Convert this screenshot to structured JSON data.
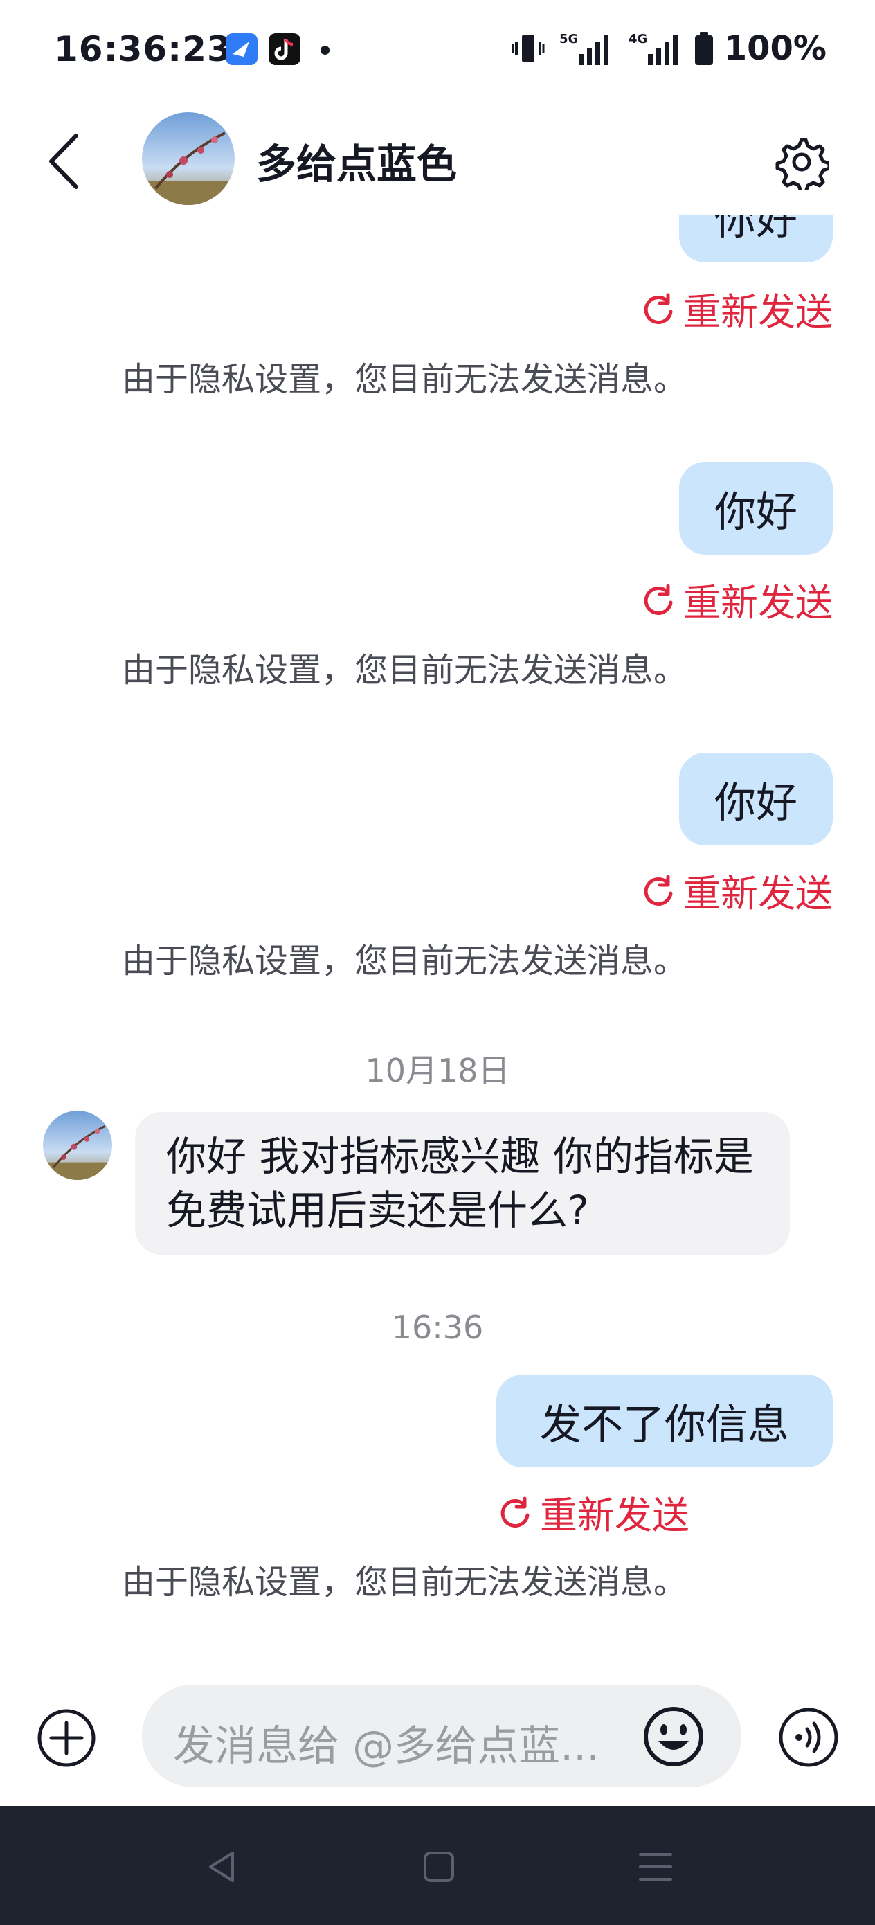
{
  "status_bar": {
    "time": "16:36:23",
    "battery": "100%",
    "net1": "5G",
    "net2": "4G"
  },
  "header": {
    "title": "多给点蓝色"
  },
  "messages": {
    "partial_bubble": "你好",
    "bubble_1": "你好",
    "bubble_2": "你好",
    "date_1": "10月18日",
    "incoming": "你好 我对指标感兴趣 你的指标是免费试用后卖还是什么?",
    "date_2": "16:36",
    "bubble_3": "发不了你信息",
    "resend_label": "重新发送",
    "notice": "由于隐私设置，您目前无法发送消息。"
  },
  "input": {
    "placeholder": "发消息给 @多给点蓝..."
  },
  "icons": [
    "back-icon",
    "gear-icon",
    "resend-icon",
    "plus-icon",
    "emoji-icon",
    "voice-icon",
    "nav-back-icon",
    "nav-home-icon",
    "nav-menu-icon"
  ],
  "colors": {
    "outgoing_bubble": "#cbe5fd",
    "resend_red": "#e0263f",
    "incoming_bubble": "#f2f2f4",
    "navbar": "#1f2330"
  }
}
